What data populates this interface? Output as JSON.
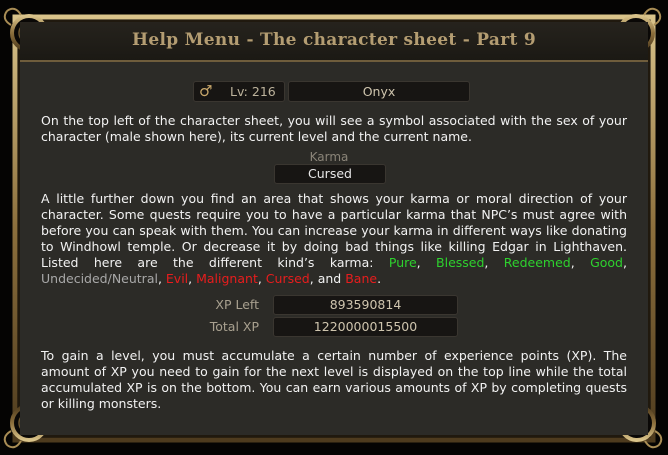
{
  "window": {
    "title": "Help Menu - The character sheet - Part 9"
  },
  "character": {
    "sex_symbol": "♂",
    "level_label": "Lv: 216",
    "name": "Onyx"
  },
  "para1": "On the top left of the character sheet, you will see a symbol associated with the sex of your character (male shown here), its current level and the current name.",
  "karma": {
    "label": "Karma",
    "value": "Cursed"
  },
  "para2": {
    "text": "A little further down you find an area that shows your karma or moral direction of your character. Some quests require you to have a particular karma that NPC’s must agree with before you can speak with them. You can increase your karma in different ways like donating to Windhowl temple. Or decrease it by doing bad things like killing Edgar in Lighthaven. Listed here are the different kind’s karma: ",
    "karma_types": [
      "Pure",
      "Blessed",
      "Redeemed",
      "Good",
      "Undecided/Neutral",
      "Evil",
      "Malignant",
      "Cursed",
      "Bane"
    ],
    "and_word": "and",
    "colors": {
      "good": "#2ed12e",
      "neutral": "#a8a8a8",
      "evil": "#e81d1d"
    }
  },
  "xp": {
    "left_label": "XP Left",
    "left_value": "893590814",
    "total_label": "Total XP",
    "total_value": "1220000015500"
  },
  "para3": "To gain a level, you must accumulate a certain number of experience points (XP). The amount of XP you need to gain for the next level is displayed on the top line while the total accumulated XP is  on the bottom.  You can earn  various  amounts of XP by  completing quests or killing monsters."
}
